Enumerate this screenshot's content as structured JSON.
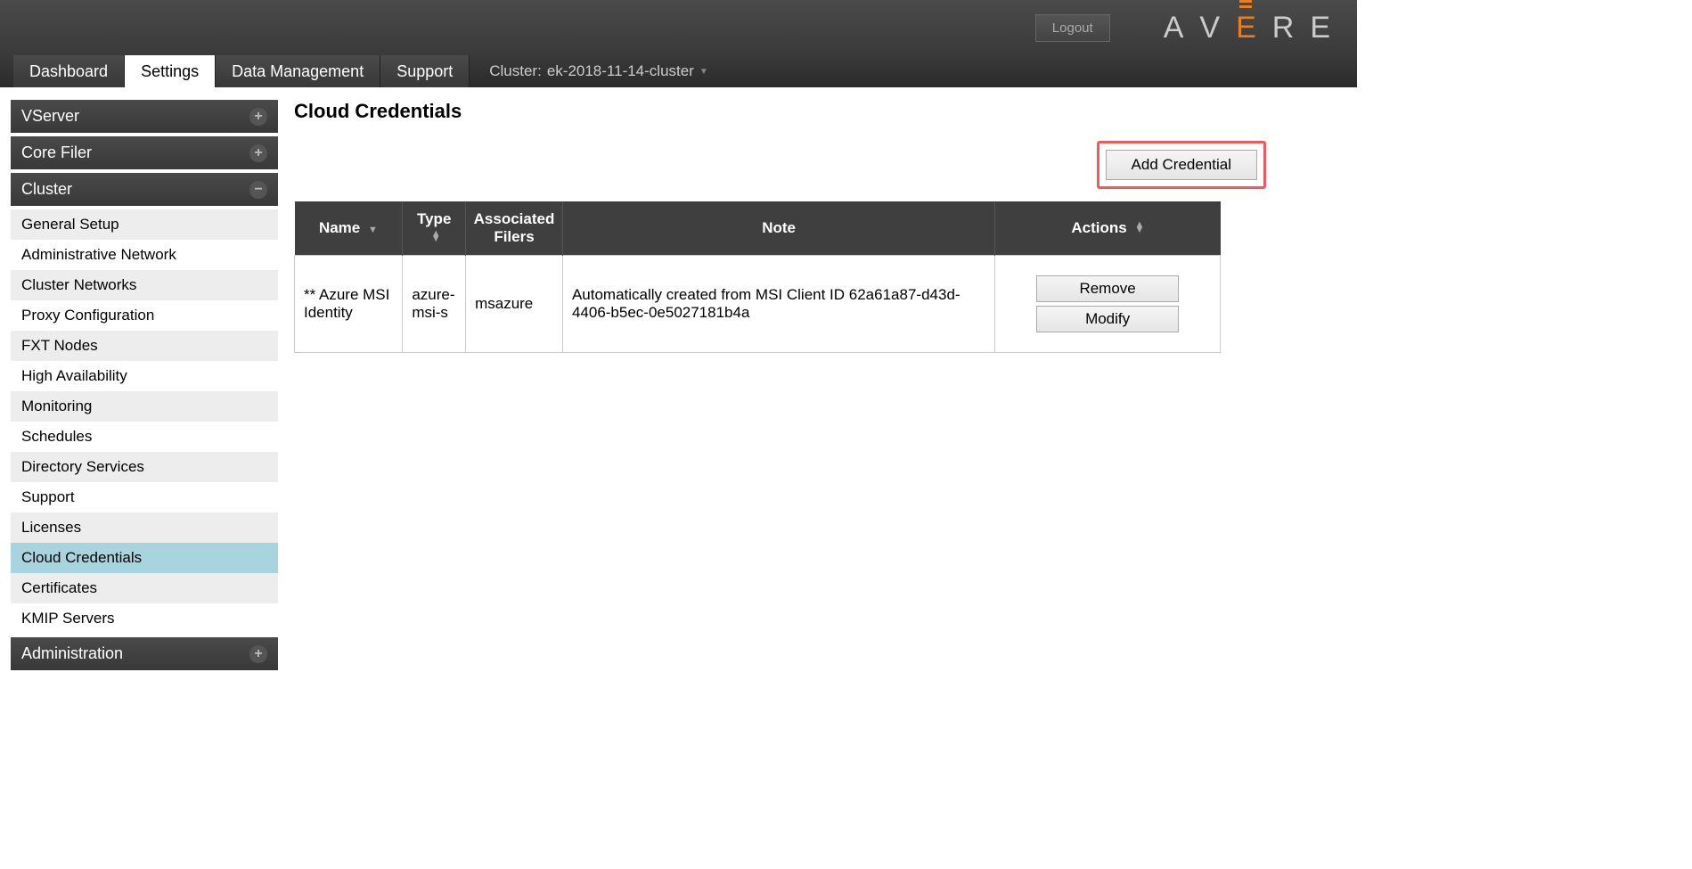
{
  "header": {
    "logout": "Logout",
    "logo_letters": [
      "A",
      "V",
      "E",
      "R",
      "E"
    ]
  },
  "tabs": {
    "items": [
      "Dashboard",
      "Settings",
      "Data Management",
      "Support"
    ],
    "active_index": 1,
    "cluster_prefix": "Cluster:",
    "cluster_name": "ek-2018-11-14-cluster"
  },
  "sidebar": {
    "groups": [
      {
        "label": "VServer",
        "expanded": false,
        "items": []
      },
      {
        "label": "Core Filer",
        "expanded": false,
        "items": []
      },
      {
        "label": "Cluster",
        "expanded": true,
        "items": [
          {
            "label": "General Setup"
          },
          {
            "label": "Administrative Network"
          },
          {
            "label": "Cluster Networks"
          },
          {
            "label": "Proxy Configuration"
          },
          {
            "label": "FXT Nodes"
          },
          {
            "label": "High Availability"
          },
          {
            "label": "Monitoring"
          },
          {
            "label": "Schedules"
          },
          {
            "label": "Directory Services"
          },
          {
            "label": "Support"
          },
          {
            "label": "Licenses"
          },
          {
            "label": "Cloud Credentials",
            "selected": true
          },
          {
            "label": "Certificates"
          },
          {
            "label": "KMIP Servers"
          }
        ]
      },
      {
        "label": "Administration",
        "expanded": false,
        "items": []
      }
    ]
  },
  "page": {
    "title": "Cloud Credentials",
    "add_button": "Add Credential",
    "table": {
      "headers": {
        "name": "Name",
        "type": "Type",
        "assoc": "Associated Filers",
        "note": "Note",
        "actions": "Actions"
      },
      "rows": [
        {
          "name": "** Azure MSI Identity",
          "type": "azure-msi-s",
          "assoc": "msazure",
          "note": "Automatically created from MSI Client ID 62a61a87-d43d-4406-b5ec-0e5027181b4a",
          "remove": "Remove",
          "modify": "Modify"
        }
      ]
    }
  }
}
